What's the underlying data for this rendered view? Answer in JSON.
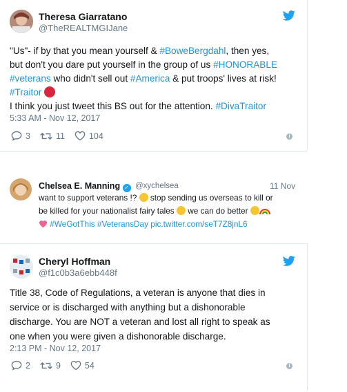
{
  "tweet1": {
    "name": "Theresa Giarratano",
    "handle": "@TheREALTMGIJane",
    "line1_a": "\"Us\"- if by that you mean yourself & ",
    "line1_link": "#BoweBergdahl",
    "line1_b": ", then yes,",
    "line2_a": "but don't you dare put yourself in the group of us ",
    "line2_link": "#HONORABLE",
    "line3_link1": "#veterans",
    "line3_a": " who didn't sell out ",
    "line3_link2": "#America",
    "line3_b": " & put troops' lives at risk!",
    "line4_link": "#Traitor",
    "line5_a": "I think you just tweet this BS out for the attention. ",
    "line5_link": "#DivaTraitor",
    "timestamp": "5:33 AM - Nov 12, 2017",
    "replies": "3",
    "retweets": "11",
    "likes": "104"
  },
  "tweet2": {
    "name": "Chelsea E. Manning",
    "handle": "@xychelsea",
    "date": "11 Nov",
    "line1_a": "want to support veterans !? ",
    "line1_b": " stop sending us overseas to kill or",
    "line2_a": "be killed for your nationalist fairy tales ",
    "line2_b": " we can do better ",
    "line3_link1": "#WeGotThis",
    "line3_link2": "#VeteransDay",
    "line3_link3": "pic.twitter.com/seT7Z8jnL6"
  },
  "tweet3": {
    "name": "Cheryl Hoffman",
    "handle": "@f1c0b3a6ebb448f",
    "line1": "Title 38, Code of Regulations, a veteran is anyone that dies in",
    "line2": "service or is discharged with anything but a dishonorable",
    "line3": "discharge. You are NOT a veteran and lost all right to speak as",
    "line4": "one when you were given a dishonorable discharge.",
    "timestamp": "2:13 PM - Nov 12, 2017",
    "replies": "2",
    "retweets": "9",
    "likes": "54"
  },
  "colors": {
    "link": "#1b95e0",
    "twitter_blue": "#1da1f2",
    "muted": "#657786"
  }
}
